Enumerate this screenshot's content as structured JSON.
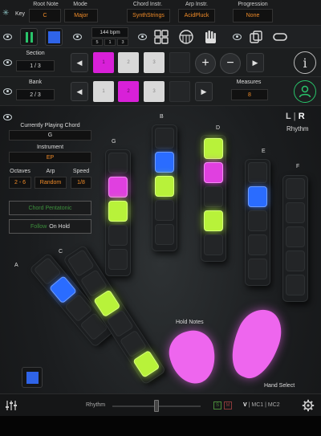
{
  "topbar": {
    "key_label": "Key",
    "fields": [
      {
        "label": "Root Note",
        "value": "C"
      },
      {
        "label": "Mode",
        "value": "Major"
      },
      {
        "label": "Chord Instr.",
        "value": "SynthStrings"
      },
      {
        "label": "Arp Instr.",
        "value": "AcidPluck"
      },
      {
        "label": "Progression",
        "value": "None"
      }
    ]
  },
  "transport": {
    "tempo": "144 bpm",
    "sig_top": "5",
    "sig_mid": "1",
    "sig_bottom": "3"
  },
  "section": {
    "title": "Section",
    "value": "1 / 3",
    "cells": [
      "1",
      "2",
      "3",
      "",
      ""
    ]
  },
  "bank": {
    "title": "Bank",
    "value": "2 / 3",
    "cells": [
      "1",
      "2",
      "3",
      "",
      ""
    ],
    "measures_label": "Measures",
    "measures_value": "8"
  },
  "panel": {
    "playing_label": "Currently Playing Chord",
    "playing_value": "G",
    "instrument_label": "Instrument",
    "instrument_value": "EP",
    "octaves_label": "Octaves",
    "octaves_value": "2 - 6",
    "arp_label": "Arp",
    "arp_value": "Random",
    "speed_label": "Speed",
    "speed_value": "1/8",
    "chord_btn": "Chord Pentatonic",
    "follow_word": "Follow",
    "follow_rest": "On Hold"
  },
  "header_right": {
    "l": "L",
    "r": "R",
    "mode": "Rhythm"
  },
  "fingers": [
    {
      "label": "A"
    },
    {
      "label": "C"
    },
    {
      "label": "G"
    },
    {
      "label": "B"
    },
    {
      "label": "D"
    },
    {
      "label": "E"
    },
    {
      "label": "F"
    }
  ],
  "hold_notes": "Hold Notes",
  "hand_select": "Hand Select",
  "bottom": {
    "mode": "Rhythm",
    "s": "S",
    "m": "M",
    "channels_v": "V",
    "channels_rest": " | MC1 | MC2"
  },
  "colors": {
    "accent_orange": "#f28c28",
    "pad_yellow": "#b8f23a",
    "pad_magenta": "#e040e0",
    "pad_blue": "#2a6cff",
    "user_green": "#29c36a"
  }
}
